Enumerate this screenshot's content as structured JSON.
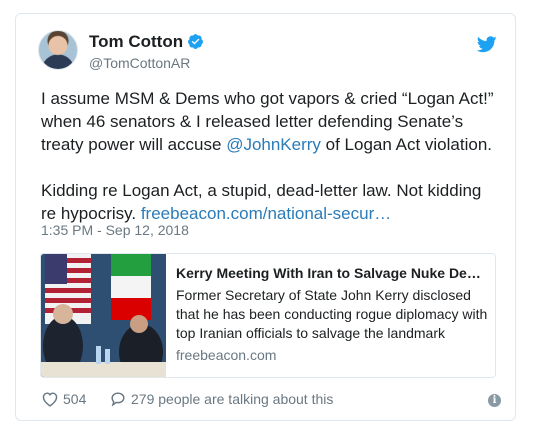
{
  "author": {
    "name": "Tom Cotton",
    "handle": "@TomCottonAR",
    "verified": true
  },
  "tweet": {
    "paragraph1_part1": "I assume MSM & Dems who got vapors & cried “Logan Act!” when 46 senators & I released letter defending Senate’s treaty power will accuse ",
    "mention": "@JohnKerry",
    "paragraph1_part2": " of Logan Act violation.",
    "paragraph2_text": "Kidding re Logan Act, a stupid, dead-letter law. Not kidding re hypocrisy. ",
    "link": "freebeacon.com/national-secur…",
    "timestamp": "1:35 PM - Sep 12, 2018"
  },
  "link_preview": {
    "title": "Kerry Meeting With Iran to Salvage Nuke De…",
    "description": "Former Secretary of State John Kerry disclosed that he has been conducting rogue diplomacy with top Iranian officials to salvage the landmark",
    "domain": "freebeacon.com"
  },
  "actions": {
    "likes": "504",
    "talking": "279 people are talking about this"
  },
  "colors": {
    "link": "#2b7bb9",
    "twitter_blue": "#1da1f2",
    "secondary_text": "#697882"
  },
  "icons": [
    "verified-badge-icon",
    "twitter-bird-icon",
    "heart-icon",
    "comment-icon",
    "info-icon"
  ]
}
